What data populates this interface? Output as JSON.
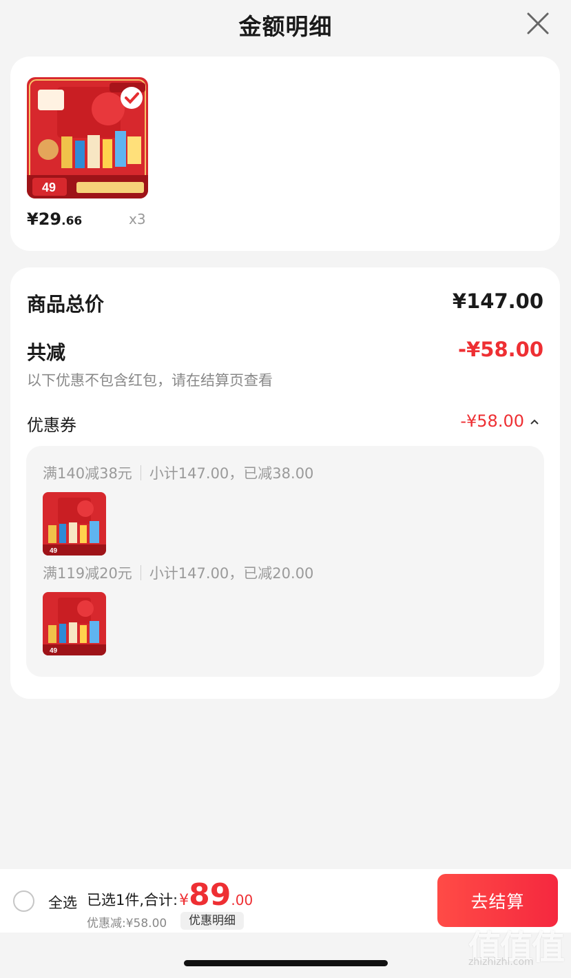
{
  "header": {
    "title": "金额明细"
  },
  "product": {
    "price_int": "¥29",
    "price_dec": ".66",
    "quantity": "x3",
    "image_alt": "徐福记 恭喜发财 礼盒"
  },
  "detail": {
    "total_label": "商品总价",
    "total_value": "¥147.00",
    "reduce_label": "共减",
    "reduce_value": "-¥58.00",
    "note": "以下优惠不包含红包，请在结算页查看",
    "coupon_label": "优惠券",
    "coupon_value": "-¥58.00",
    "coupons": [
      {
        "rule": "满140减38元",
        "summary": "小计147.00，已减38.00"
      },
      {
        "rule": "满119减20元",
        "summary": "小计147.00，已减20.00"
      }
    ]
  },
  "bottom": {
    "select_all": "全选",
    "selected_text": "已选1件,合计:",
    "currency": "¥",
    "amount_int": "89",
    "amount_dec": ".00",
    "discount": "优惠减:¥58.00",
    "detail_link": "优惠明细",
    "checkout": "去结算"
  },
  "watermark": {
    "main": "值值值",
    "sub": "zhizhizhi.com"
  },
  "colors": {
    "accent": "#ee2f33",
    "card": "#ffffff",
    "background": "#f4f4f4"
  }
}
